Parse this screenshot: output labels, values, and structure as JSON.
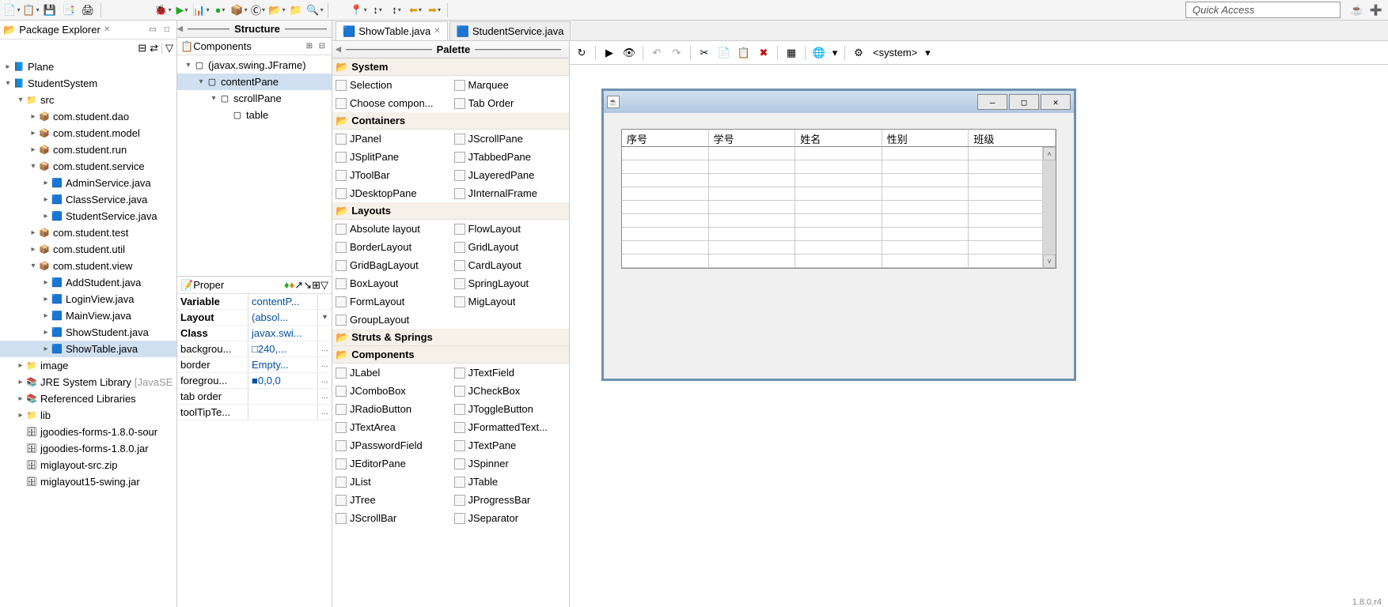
{
  "quick_access": "Quick Access",
  "status_version": "1.8.0.r4",
  "package_explorer": {
    "title": "Package Explorer",
    "tree": [
      {
        "level": 0,
        "arrow": "▸",
        "icon": "proj",
        "label": "Plane"
      },
      {
        "level": 0,
        "arrow": "▾",
        "icon": "proj",
        "label": "StudentSystem"
      },
      {
        "level": 1,
        "arrow": "▾",
        "icon": "srcfolder",
        "label": "src"
      },
      {
        "level": 2,
        "arrow": "▸",
        "icon": "pkg",
        "label": "com.student.dao"
      },
      {
        "level": 2,
        "arrow": "▸",
        "icon": "pkg",
        "label": "com.student.model"
      },
      {
        "level": 2,
        "arrow": "▸",
        "icon": "pkg",
        "label": "com.student.run"
      },
      {
        "level": 2,
        "arrow": "▾",
        "icon": "pkg",
        "label": "com.student.service"
      },
      {
        "level": 3,
        "arrow": "▸",
        "icon": "java",
        "label": "AdminService.java"
      },
      {
        "level": 3,
        "arrow": "▸",
        "icon": "java",
        "label": "ClassService.java"
      },
      {
        "level": 3,
        "arrow": "▸",
        "icon": "java",
        "label": "StudentService.java"
      },
      {
        "level": 2,
        "arrow": "▸",
        "icon": "pkg",
        "label": "com.student.test"
      },
      {
        "level": 2,
        "arrow": "▸",
        "icon": "pkg",
        "label": "com.student.util"
      },
      {
        "level": 2,
        "arrow": "▾",
        "icon": "pkg",
        "label": "com.student.view"
      },
      {
        "level": 3,
        "arrow": "▸",
        "icon": "java",
        "label": "AddStudent.java"
      },
      {
        "level": 3,
        "arrow": "▸",
        "icon": "java",
        "label": "LoginView.java"
      },
      {
        "level": 3,
        "arrow": "▸",
        "icon": "java",
        "label": "MainView.java"
      },
      {
        "level": 3,
        "arrow": "▸",
        "icon": "java",
        "label": "ShowStudent.java"
      },
      {
        "level": 3,
        "arrow": "▸",
        "icon": "java",
        "label": "ShowTable.java",
        "selected": true
      },
      {
        "level": 1,
        "arrow": "▸",
        "icon": "folder",
        "label": "image"
      },
      {
        "level": 1,
        "arrow": "▸",
        "icon": "lib",
        "label": "JRE System Library",
        "suffix": "[JavaSE"
      },
      {
        "level": 1,
        "arrow": "▸",
        "icon": "lib",
        "label": "Referenced Libraries"
      },
      {
        "level": 1,
        "arrow": "▸",
        "icon": "folder",
        "label": "lib"
      },
      {
        "level": 1,
        "arrow": "",
        "icon": "jar",
        "label": "jgoodies-forms-1.8.0-sour"
      },
      {
        "level": 1,
        "arrow": "",
        "icon": "jar",
        "label": "jgoodies-forms-1.8.0.jar"
      },
      {
        "level": 1,
        "arrow": "",
        "icon": "jar",
        "label": "miglayout-src.zip"
      },
      {
        "level": 1,
        "arrow": "",
        "icon": "jar",
        "label": "miglayout15-swing.jar"
      }
    ]
  },
  "structure": {
    "title": "Structure",
    "components_title": "Components",
    "tree": [
      {
        "level": 0,
        "arrow": "▾",
        "label": "(javax.swing.JFrame)"
      },
      {
        "level": 1,
        "arrow": "▾",
        "label": "contentPane",
        "selected": true
      },
      {
        "level": 2,
        "arrow": "▾",
        "label": "scrollPane"
      },
      {
        "level": 3,
        "arrow": "",
        "label": "table"
      }
    ],
    "properties_title": "Proper",
    "props": [
      {
        "k": "Variable",
        "v": "contentP...",
        "btn": ""
      },
      {
        "k": "Layout",
        "v": "(absol...",
        "btn": "▾"
      },
      {
        "k": "Class",
        "v": "javax.swi...",
        "btn": ""
      },
      {
        "k": "backgrou...",
        "v": "□240,...",
        "btn": "…"
      },
      {
        "k": "border",
        "v": "Empty...",
        "btn": "…"
      },
      {
        "k": "foregrou...",
        "v": "■0,0,0",
        "btn": "…"
      },
      {
        "k": "tab order",
        "v": "",
        "btn": "…"
      },
      {
        "k": "toolTipTe...",
        "v": "",
        "btn": "…"
      }
    ]
  },
  "tabs": [
    {
      "label": "ShowTable.java",
      "active": true,
      "icon": "java"
    },
    {
      "label": "StudentService.java",
      "active": false,
      "icon": "java"
    }
  ],
  "palette": {
    "title": "Palette",
    "sections": [
      {
        "cat": "System",
        "items": [
          "Selection",
          "Marquee",
          "Choose compon...",
          "Tab Order"
        ]
      },
      {
        "cat": "Containers",
        "items": [
          "JPanel",
          "JScrollPane",
          "JSplitPane",
          "JTabbedPane",
          "JToolBar",
          "JLayeredPane",
          "JDesktopPane",
          "JInternalFrame"
        ]
      },
      {
        "cat": "Layouts",
        "items": [
          "Absolute layout",
          "FlowLayout",
          "BorderLayout",
          "GridLayout",
          "GridBagLayout",
          "CardLayout",
          "BoxLayout",
          "SpringLayout",
          "FormLayout",
          "MigLayout",
          "GroupLayout"
        ]
      },
      {
        "cat": "Struts & Springs",
        "items": []
      },
      {
        "cat": "Components",
        "items": [
          "JLabel",
          "JTextField",
          "JComboBox",
          "JCheckBox",
          "JRadioButton",
          "JToggleButton",
          "JTextArea",
          "JFormattedText...",
          "JPasswordField",
          "JTextPane",
          "JEditorPane",
          "JSpinner",
          "JList",
          "JTable",
          "JTree",
          "JProgressBar",
          "JScrollBar",
          "JSeparator"
        ]
      }
    ]
  },
  "designer": {
    "system_label": "<system>",
    "table_headers": [
      "序号",
      "学号",
      "姓名",
      "性别",
      "班级"
    ],
    "empty_rows": 9
  }
}
